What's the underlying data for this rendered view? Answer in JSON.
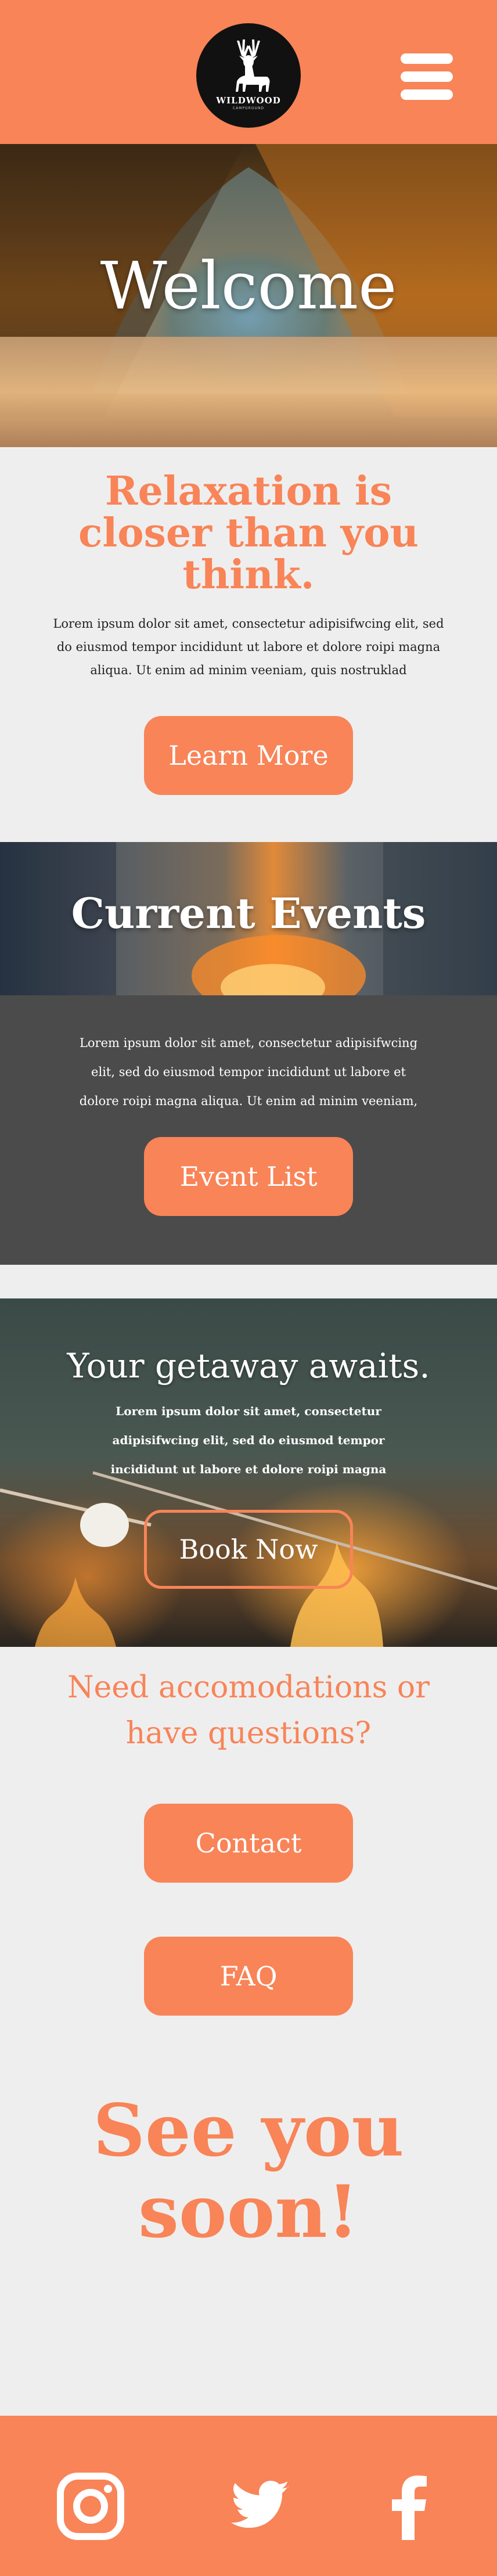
{
  "header": {
    "logo_name": "WILDWOOD",
    "logo_sub": "CAMPGROUND",
    "menu_icon": "hamburger-menu-icon"
  },
  "hero": {
    "title": "Welcome"
  },
  "intro": {
    "heading_lines": [
      "Relaxation is",
      "closer than you",
      "think."
    ],
    "body_lines": [
      "Lorem ipsum dolor sit amet, consectetur adipisifwcing elit, sed",
      "do eiusmod tempor incididunt ut labore et dolore roipi magna",
      "aliqua. Ut enim ad minim veeniam, quis nostruklad"
    ],
    "button": "Learn More"
  },
  "events": {
    "title": "Current Events",
    "body_lines": [
      "Lorem ipsum dolor sit amet, consectetur adipisifwcing",
      "elit, sed do eiusmod tempor incididunt ut labore et",
      "dolore roipi magna aliqua. Ut enim ad minim veeniam,"
    ],
    "button": "Event List"
  },
  "getaway": {
    "title": "Your getaway awaits.",
    "body_lines": [
      "Lorem ipsum dolor sit amet, consectetur",
      "adipisifwcing elit, sed do eiusmod tempor",
      "incididunt ut labore et dolore roipi magna"
    ],
    "button": "Book Now"
  },
  "questions": {
    "heading_lines": [
      "Need accomodations or",
      "have questions?"
    ],
    "contact_button": "Contact",
    "faq_button": "FAQ"
  },
  "farewell": {
    "lines": [
      "See you",
      "soon!"
    ]
  },
  "footer": {
    "icons": [
      "instagram-icon",
      "twitter-icon",
      "facebook-icon"
    ]
  },
  "colors": {
    "accent": "#f88458",
    "dark_panel": "#4b4b4b",
    "background": "#efeeee"
  }
}
